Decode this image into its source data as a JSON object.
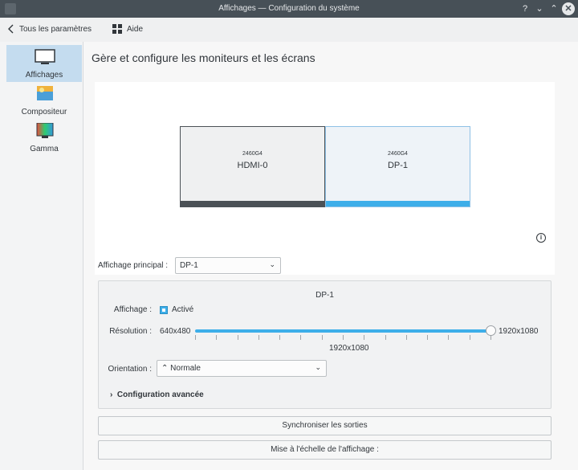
{
  "window": {
    "title": "Affichages — Configuration du système",
    "controls": [
      "?",
      "⌄",
      "⌃",
      "✕"
    ]
  },
  "toolbar": {
    "back_label": "Tous les paramètres",
    "help_label": "Aide"
  },
  "sidebar": {
    "items": [
      {
        "label": "Affichages",
        "icon": "display-icon",
        "active": true
      },
      {
        "label": "Compositeur",
        "icon": "compositor-icon",
        "active": false
      },
      {
        "label": "Gamma",
        "icon": "gamma-icon",
        "active": false
      }
    ]
  },
  "main": {
    "heading": "Gère et configure les moniteurs et les écrans",
    "monitors": [
      {
        "model": "2460G4",
        "name": "HDMI-0",
        "selected": false
      },
      {
        "model": "2460G4",
        "name": "DP-1",
        "selected": true
      }
    ],
    "primary": {
      "label": "Affichage principal :",
      "value": "DP-1"
    },
    "output": {
      "name": "DP-1",
      "display_label": "Affichage :",
      "enabled_label": "Activé",
      "enabled": true,
      "resolution_label": "Résolution :",
      "resolution_min": "640x480",
      "resolution_max": "1920x1080",
      "resolution_current": "1920x1080",
      "resolution_position": 1.0,
      "orientation_label": "Orientation :",
      "orientation_value": "Normale",
      "advanced_label": "Configuration avancée"
    },
    "sync_button": "Synchroniser les sorties",
    "scale_button": "Mise à l'échelle de l'affichage :"
  },
  "colors": {
    "accent": "#3daee9",
    "titlebar": "#475057",
    "selection": "#c4dcef"
  }
}
